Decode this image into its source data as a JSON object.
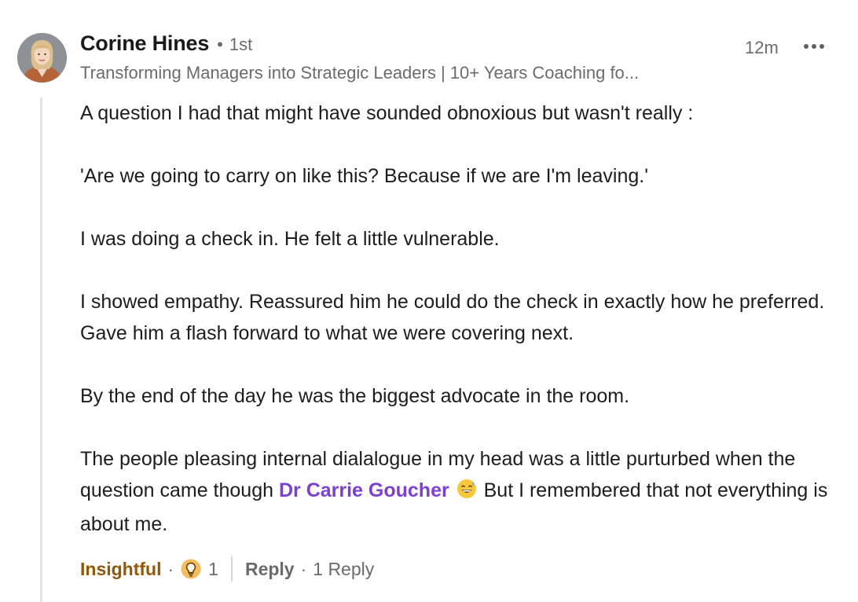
{
  "comment": {
    "author": {
      "name": "Corine Hines",
      "degree": "1st",
      "headline": "Transforming Managers into Strategic Leaders | 10+ Years Coaching fo..."
    },
    "timestamp": "12m",
    "more_icon": "ellipsis-icon",
    "body": {
      "p1": "A question I had that might have sounded obnoxious but wasn't really :",
      "p2": "'Are we going to carry on like this? Because if we are I'm leaving.'",
      "p3": "I was doing a check in. He felt a little vulnerable.",
      "p4": "I showed empathy. Reassured him he could do the check in exactly how he preferred. Gave him a flash forward to what we were covering next.",
      "p5": "By the end of the day he was the biggest advocate in the room.",
      "p6_before": "The people pleasing internal dialalogue in my head was a little purturbed when the question came though ",
      "p6_mention": "Dr Carrie Goucher",
      "p6_after": " But I remembered that not everything is about me."
    },
    "emoji": "grinning-sweat-emoji",
    "actions": {
      "reaction_label": "Insightful",
      "reaction_icon": "lightbulb-icon",
      "reaction_count": "1",
      "reply_label": "Reply",
      "reply_count": "1 Reply"
    },
    "colors": {
      "mention": "#7c3fd6",
      "insightful": "#915907",
      "muted": "#6b6b6b"
    }
  }
}
